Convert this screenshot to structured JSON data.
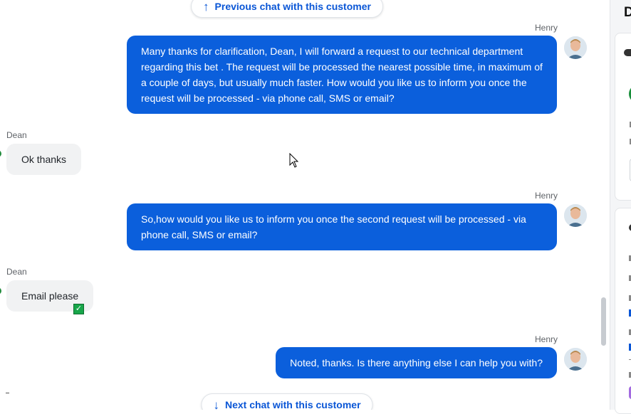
{
  "navigation": {
    "previous_chat_label": "Previous chat with this customer",
    "next_chat_label": "Next chat with this customer"
  },
  "messages": [
    {
      "author": "Henry",
      "role": "agent",
      "text": "Many thanks for clarification, Dean, I will forward a request to our technical department regarding this bet . The request will be processed the nearest possible time, in maximum of a couple of days, but usually much faster. How would you like us to inform you once the request will be processed - via phone call, SMS or email?"
    },
    {
      "author": "Dean",
      "role": "customer",
      "text": "Ok thanks"
    },
    {
      "author": "Henry",
      "role": "agent",
      "text": "So,how would you like us to inform you once the second request will be processed - via phone call, SMS or email?"
    },
    {
      "author": "Dean",
      "role": "customer",
      "text": "Email please",
      "read_receipt_icon": "check-icon"
    },
    {
      "author": "Henry",
      "role": "agent",
      "text": "Noted, thanks. Is there anything else I can help you with?"
    }
  ],
  "side_panel": {
    "title_initial": "D"
  },
  "colors": {
    "agent_bubble": "#0b5fdc",
    "customer_bubble": "#f1f2f3",
    "link": "#0a56d6",
    "online_status": "#1f8a3a"
  }
}
